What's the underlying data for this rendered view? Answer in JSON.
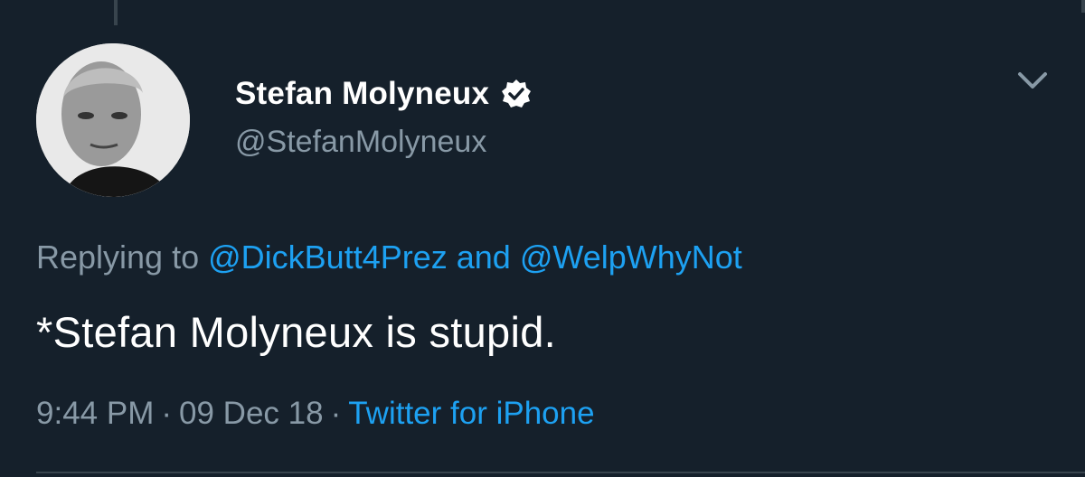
{
  "colors": {
    "background": "#15202b",
    "primary_text": "#ffffff",
    "secondary_text": "#8899a6",
    "link": "#1da1f2",
    "divider": "#38444d"
  },
  "author": {
    "display_name": "Stefan Molyneux",
    "handle": "@StefanMolyneux",
    "verified": true,
    "avatar_icon": "profile-photo"
  },
  "reply": {
    "prefix": "Replying to",
    "mention_1": "@DickButt4Prez",
    "conjunction": "and",
    "mention_2": "@WelpWhyNot"
  },
  "tweet": {
    "text": "*Stefan Molyneux is stupid."
  },
  "meta": {
    "time": "9:44 PM",
    "separator": "·",
    "date": "09 Dec 18",
    "source": "Twitter for iPhone"
  },
  "icons": {
    "verified": "verified-badge-icon",
    "menu": "chevron-down-icon"
  }
}
